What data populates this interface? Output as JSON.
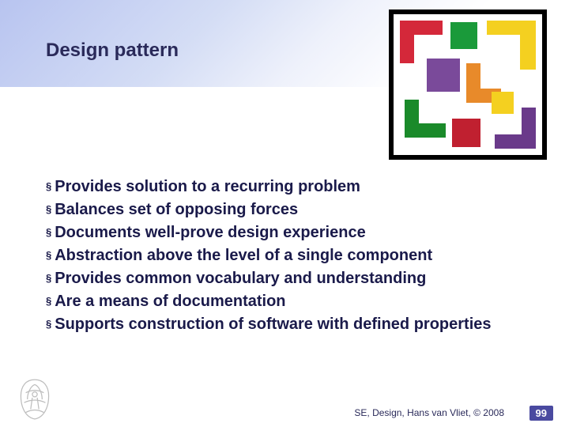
{
  "title": "Design pattern",
  "bullets": [
    "Provides solution to a recurring problem",
    "Balances set of opposing forces",
    "Documents well-prove design experience",
    "Abstraction above the level of a single component",
    "Provides common vocabulary and understanding",
    "Are a means of documentation",
    "Supports construction of software with defined properties"
  ],
  "footer": {
    "citation": "SE, Design, Hans van Vliet, © 2008",
    "page": "99"
  }
}
